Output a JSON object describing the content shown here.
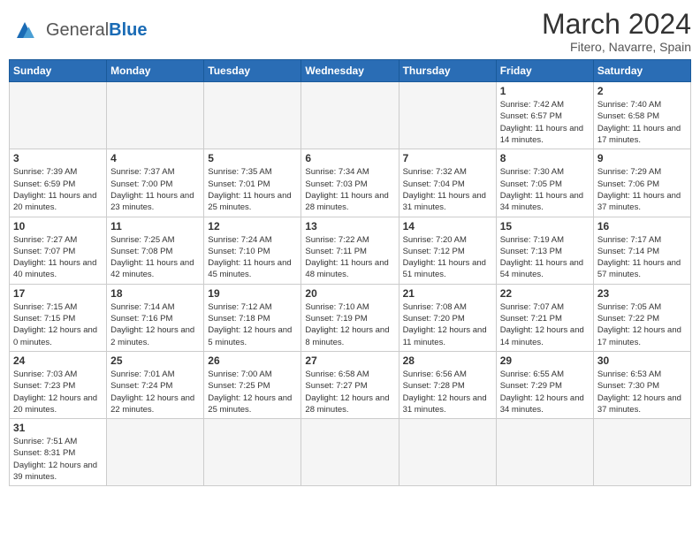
{
  "header": {
    "logo_general": "General",
    "logo_blue": "Blue",
    "month_year": "March 2024",
    "location": "Fitero, Navarre, Spain"
  },
  "weekdays": [
    "Sunday",
    "Monday",
    "Tuesday",
    "Wednesday",
    "Thursday",
    "Friday",
    "Saturday"
  ],
  "weeks": [
    [
      {
        "day": "",
        "info": ""
      },
      {
        "day": "",
        "info": ""
      },
      {
        "day": "",
        "info": ""
      },
      {
        "day": "",
        "info": ""
      },
      {
        "day": "",
        "info": ""
      },
      {
        "day": "1",
        "info": "Sunrise: 7:42 AM\nSunset: 6:57 PM\nDaylight: 11 hours and 14 minutes."
      },
      {
        "day": "2",
        "info": "Sunrise: 7:40 AM\nSunset: 6:58 PM\nDaylight: 11 hours and 17 minutes."
      }
    ],
    [
      {
        "day": "3",
        "info": "Sunrise: 7:39 AM\nSunset: 6:59 PM\nDaylight: 11 hours and 20 minutes."
      },
      {
        "day": "4",
        "info": "Sunrise: 7:37 AM\nSunset: 7:00 PM\nDaylight: 11 hours and 23 minutes."
      },
      {
        "day": "5",
        "info": "Sunrise: 7:35 AM\nSunset: 7:01 PM\nDaylight: 11 hours and 25 minutes."
      },
      {
        "day": "6",
        "info": "Sunrise: 7:34 AM\nSunset: 7:03 PM\nDaylight: 11 hours and 28 minutes."
      },
      {
        "day": "7",
        "info": "Sunrise: 7:32 AM\nSunset: 7:04 PM\nDaylight: 11 hours and 31 minutes."
      },
      {
        "day": "8",
        "info": "Sunrise: 7:30 AM\nSunset: 7:05 PM\nDaylight: 11 hours and 34 minutes."
      },
      {
        "day": "9",
        "info": "Sunrise: 7:29 AM\nSunset: 7:06 PM\nDaylight: 11 hours and 37 minutes."
      }
    ],
    [
      {
        "day": "10",
        "info": "Sunrise: 7:27 AM\nSunset: 7:07 PM\nDaylight: 11 hours and 40 minutes."
      },
      {
        "day": "11",
        "info": "Sunrise: 7:25 AM\nSunset: 7:08 PM\nDaylight: 11 hours and 42 minutes."
      },
      {
        "day": "12",
        "info": "Sunrise: 7:24 AM\nSunset: 7:10 PM\nDaylight: 11 hours and 45 minutes."
      },
      {
        "day": "13",
        "info": "Sunrise: 7:22 AM\nSunset: 7:11 PM\nDaylight: 11 hours and 48 minutes."
      },
      {
        "day": "14",
        "info": "Sunrise: 7:20 AM\nSunset: 7:12 PM\nDaylight: 11 hours and 51 minutes."
      },
      {
        "day": "15",
        "info": "Sunrise: 7:19 AM\nSunset: 7:13 PM\nDaylight: 11 hours and 54 minutes."
      },
      {
        "day": "16",
        "info": "Sunrise: 7:17 AM\nSunset: 7:14 PM\nDaylight: 11 hours and 57 minutes."
      }
    ],
    [
      {
        "day": "17",
        "info": "Sunrise: 7:15 AM\nSunset: 7:15 PM\nDaylight: 12 hours and 0 minutes."
      },
      {
        "day": "18",
        "info": "Sunrise: 7:14 AM\nSunset: 7:16 PM\nDaylight: 12 hours and 2 minutes."
      },
      {
        "day": "19",
        "info": "Sunrise: 7:12 AM\nSunset: 7:18 PM\nDaylight: 12 hours and 5 minutes."
      },
      {
        "day": "20",
        "info": "Sunrise: 7:10 AM\nSunset: 7:19 PM\nDaylight: 12 hours and 8 minutes."
      },
      {
        "day": "21",
        "info": "Sunrise: 7:08 AM\nSunset: 7:20 PM\nDaylight: 12 hours and 11 minutes."
      },
      {
        "day": "22",
        "info": "Sunrise: 7:07 AM\nSunset: 7:21 PM\nDaylight: 12 hours and 14 minutes."
      },
      {
        "day": "23",
        "info": "Sunrise: 7:05 AM\nSunset: 7:22 PM\nDaylight: 12 hours and 17 minutes."
      }
    ],
    [
      {
        "day": "24",
        "info": "Sunrise: 7:03 AM\nSunset: 7:23 PM\nDaylight: 12 hours and 20 minutes."
      },
      {
        "day": "25",
        "info": "Sunrise: 7:01 AM\nSunset: 7:24 PM\nDaylight: 12 hours and 22 minutes."
      },
      {
        "day": "26",
        "info": "Sunrise: 7:00 AM\nSunset: 7:25 PM\nDaylight: 12 hours and 25 minutes."
      },
      {
        "day": "27",
        "info": "Sunrise: 6:58 AM\nSunset: 7:27 PM\nDaylight: 12 hours and 28 minutes."
      },
      {
        "day": "28",
        "info": "Sunrise: 6:56 AM\nSunset: 7:28 PM\nDaylight: 12 hours and 31 minutes."
      },
      {
        "day": "29",
        "info": "Sunrise: 6:55 AM\nSunset: 7:29 PM\nDaylight: 12 hours and 34 minutes."
      },
      {
        "day": "30",
        "info": "Sunrise: 6:53 AM\nSunset: 7:30 PM\nDaylight: 12 hours and 37 minutes."
      }
    ],
    [
      {
        "day": "31",
        "info": "Sunrise: 7:51 AM\nSunset: 8:31 PM\nDaylight: 12 hours and 39 minutes."
      },
      {
        "day": "",
        "info": ""
      },
      {
        "day": "",
        "info": ""
      },
      {
        "day": "",
        "info": ""
      },
      {
        "day": "",
        "info": ""
      },
      {
        "day": "",
        "info": ""
      },
      {
        "day": "",
        "info": ""
      }
    ]
  ]
}
